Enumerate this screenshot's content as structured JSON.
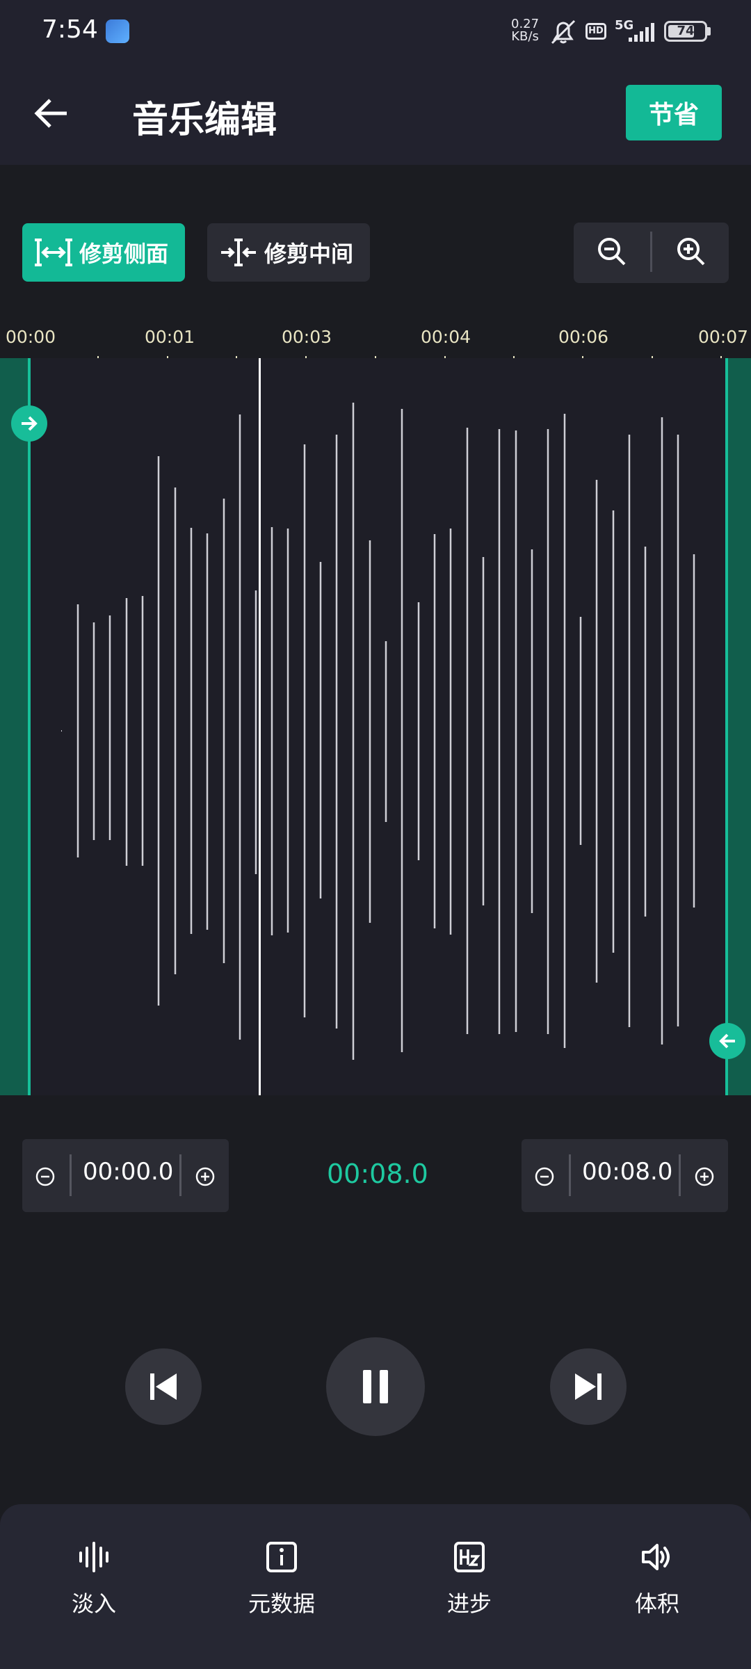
{
  "status_bar": {
    "time": "7:54",
    "net_speed_value": "0.27",
    "net_speed_unit": "KB/s",
    "hd": "HD",
    "network": "5G",
    "battery": "74",
    "battery_level": 0.74,
    "icons": [
      "app-icon",
      "mute-icon",
      "signal-icon",
      "battery-icon"
    ]
  },
  "header": {
    "title": "音乐编辑",
    "save_label": "节省"
  },
  "toolbar": {
    "trim_sides_label": "修剪侧面",
    "trim_middle_label": "修剪中间"
  },
  "timeline": {
    "ticks": [
      "00:00",
      "00:01",
      "00:03",
      "00:04",
      "00:06",
      "00:07"
    ]
  },
  "trim": {
    "start_value": "00:00.0",
    "end_value": "00:08.0",
    "duration": "00:08.0"
  },
  "bottom_nav": {
    "items": [
      {
        "label": "淡入",
        "icon": "waveform-icon"
      },
      {
        "label": "元数据",
        "icon": "info-icon"
      },
      {
        "label": "进步",
        "icon": "hz-icon"
      },
      {
        "label": "体积",
        "icon": "volume-icon"
      }
    ]
  },
  "colors": {
    "accent": "#13b996",
    "background": "#1b1c21",
    "header": "#22222e",
    "selection": "#115e4c",
    "tick_label": "#e9e5c3",
    "duration_text": "#1ec9a0"
  }
}
